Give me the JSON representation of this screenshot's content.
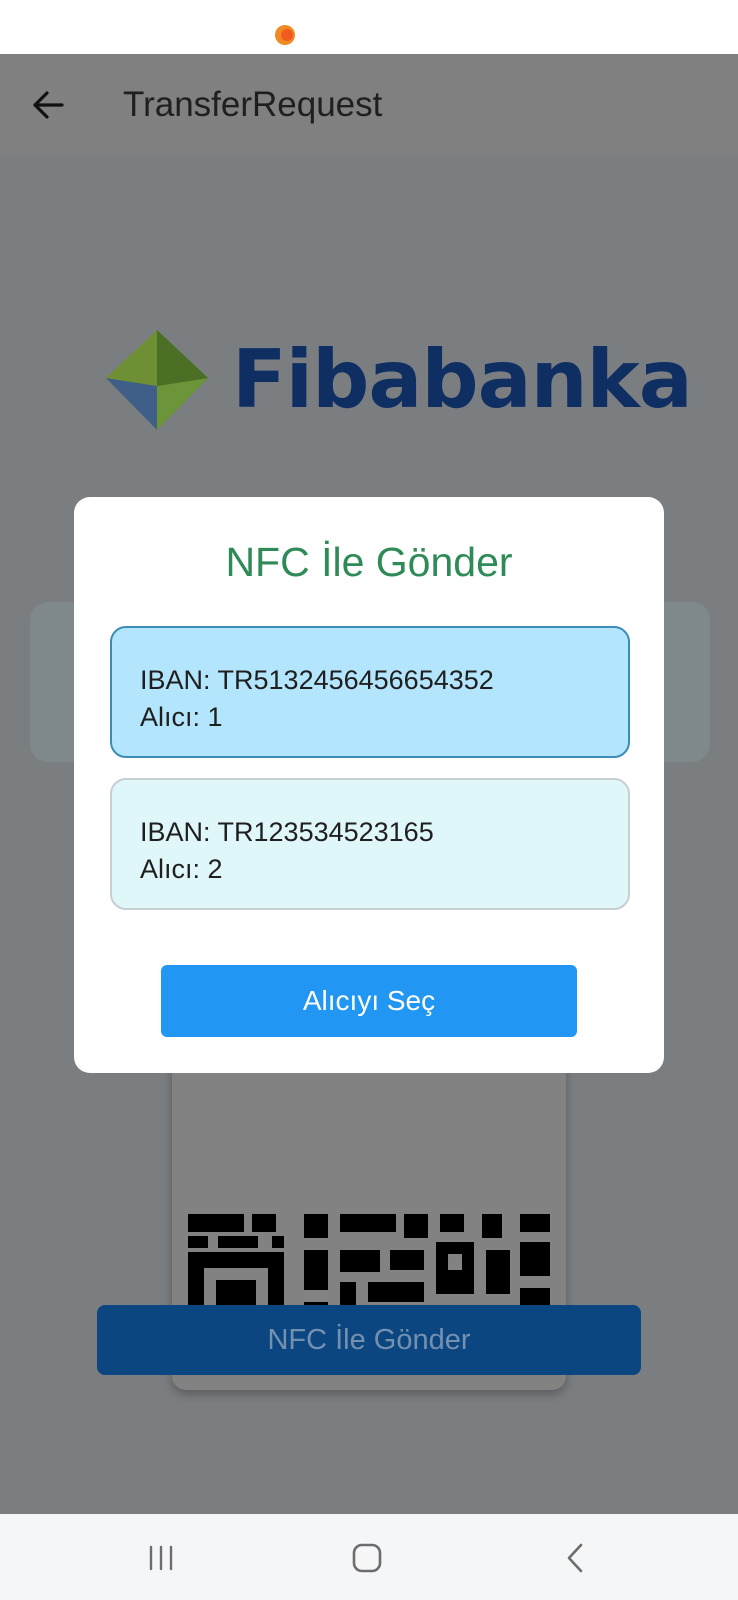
{
  "app_bar": {
    "title": "TransferRequest"
  },
  "logo": {
    "text": "Fibabanka"
  },
  "dialog": {
    "title": "NFC İle Gönder",
    "recipients": [
      {
        "iban": "IBAN: TR5132456456654352",
        "alici": "Alıcı: 1",
        "selected": true
      },
      {
        "iban": "IBAN: TR123534523165",
        "alici": "Alıcı: 2",
        "selected": false
      }
    ],
    "select_button": "Alıcıyı Seç"
  },
  "background": {
    "nfc_button": "NFC İle Gönder"
  },
  "nav": {
    "icons": [
      "recent-apps-icon",
      "home-icon",
      "back-icon"
    ]
  },
  "colors": {
    "accent": "#2196f3",
    "title_green": "#2e8b57",
    "brand_blue": "#0f2e62",
    "selected_bg": "#b3e5fc",
    "unselected_bg": "#e0f7fa"
  }
}
